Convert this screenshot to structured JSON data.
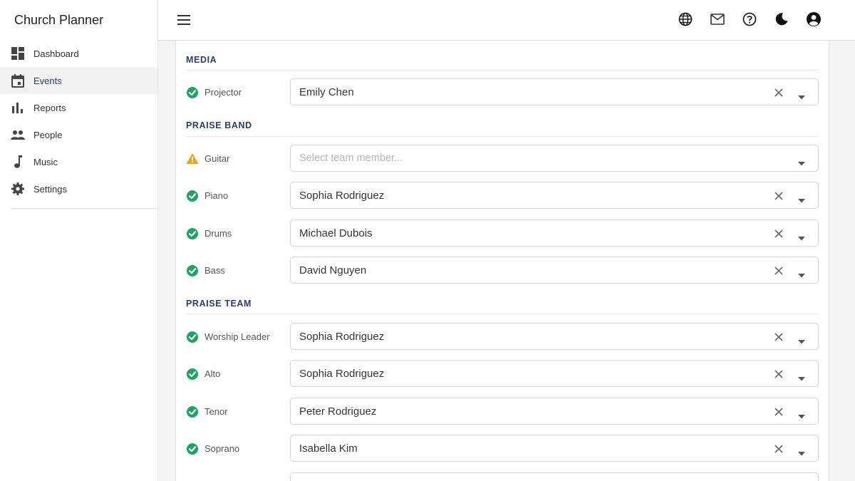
{
  "app": {
    "title": "Church Planner"
  },
  "sidebar": {
    "items": [
      {
        "label": "Dashboard",
        "icon": "dashboard-icon",
        "active": false
      },
      {
        "label": "Events",
        "icon": "calendar-icon",
        "active": true
      },
      {
        "label": "Reports",
        "icon": "bar-chart-icon",
        "active": false
      },
      {
        "label": "People",
        "icon": "people-icon",
        "active": false
      },
      {
        "label": "Music",
        "icon": "music-note-icon",
        "active": false
      },
      {
        "label": "Settings",
        "icon": "gear-icon",
        "active": false
      }
    ]
  },
  "header": {
    "icons": [
      "menu-icon",
      "globe-icon",
      "mail-icon",
      "help-icon",
      "dark-mode-icon",
      "account-icon"
    ]
  },
  "colors": {
    "ok": "#21a366",
    "warning": "#f0a020",
    "section": "#2d3e63",
    "active_text": "#2f3b6b"
  },
  "sections": [
    {
      "title": "MEDIA",
      "rows": [
        {
          "role": "Projector",
          "status": "ok",
          "value": "Emily Chen"
        }
      ]
    },
    {
      "title": "PRAISE BAND",
      "rows": [
        {
          "role": "Guitar",
          "status": "warning",
          "value": "",
          "placeholder": "Select team member..."
        },
        {
          "role": "Piano",
          "status": "ok",
          "value": "Sophia Rodriguez"
        },
        {
          "role": "Drums",
          "status": "ok",
          "value": "Michael Dubois"
        },
        {
          "role": "Bass",
          "status": "ok",
          "value": "David Nguyen"
        }
      ]
    },
    {
      "title": "PRAISE TEAM",
      "rows": [
        {
          "role": "Worship Leader",
          "status": "ok",
          "value": "Sophia Rodriguez"
        },
        {
          "role": "Alto",
          "status": "ok",
          "value": "Sophia Rodriguez"
        },
        {
          "role": "Tenor",
          "status": "ok",
          "value": "Peter Rodriguez"
        },
        {
          "role": "Soprano",
          "status": "ok",
          "value": "Isabella Kim"
        }
      ]
    }
  ]
}
